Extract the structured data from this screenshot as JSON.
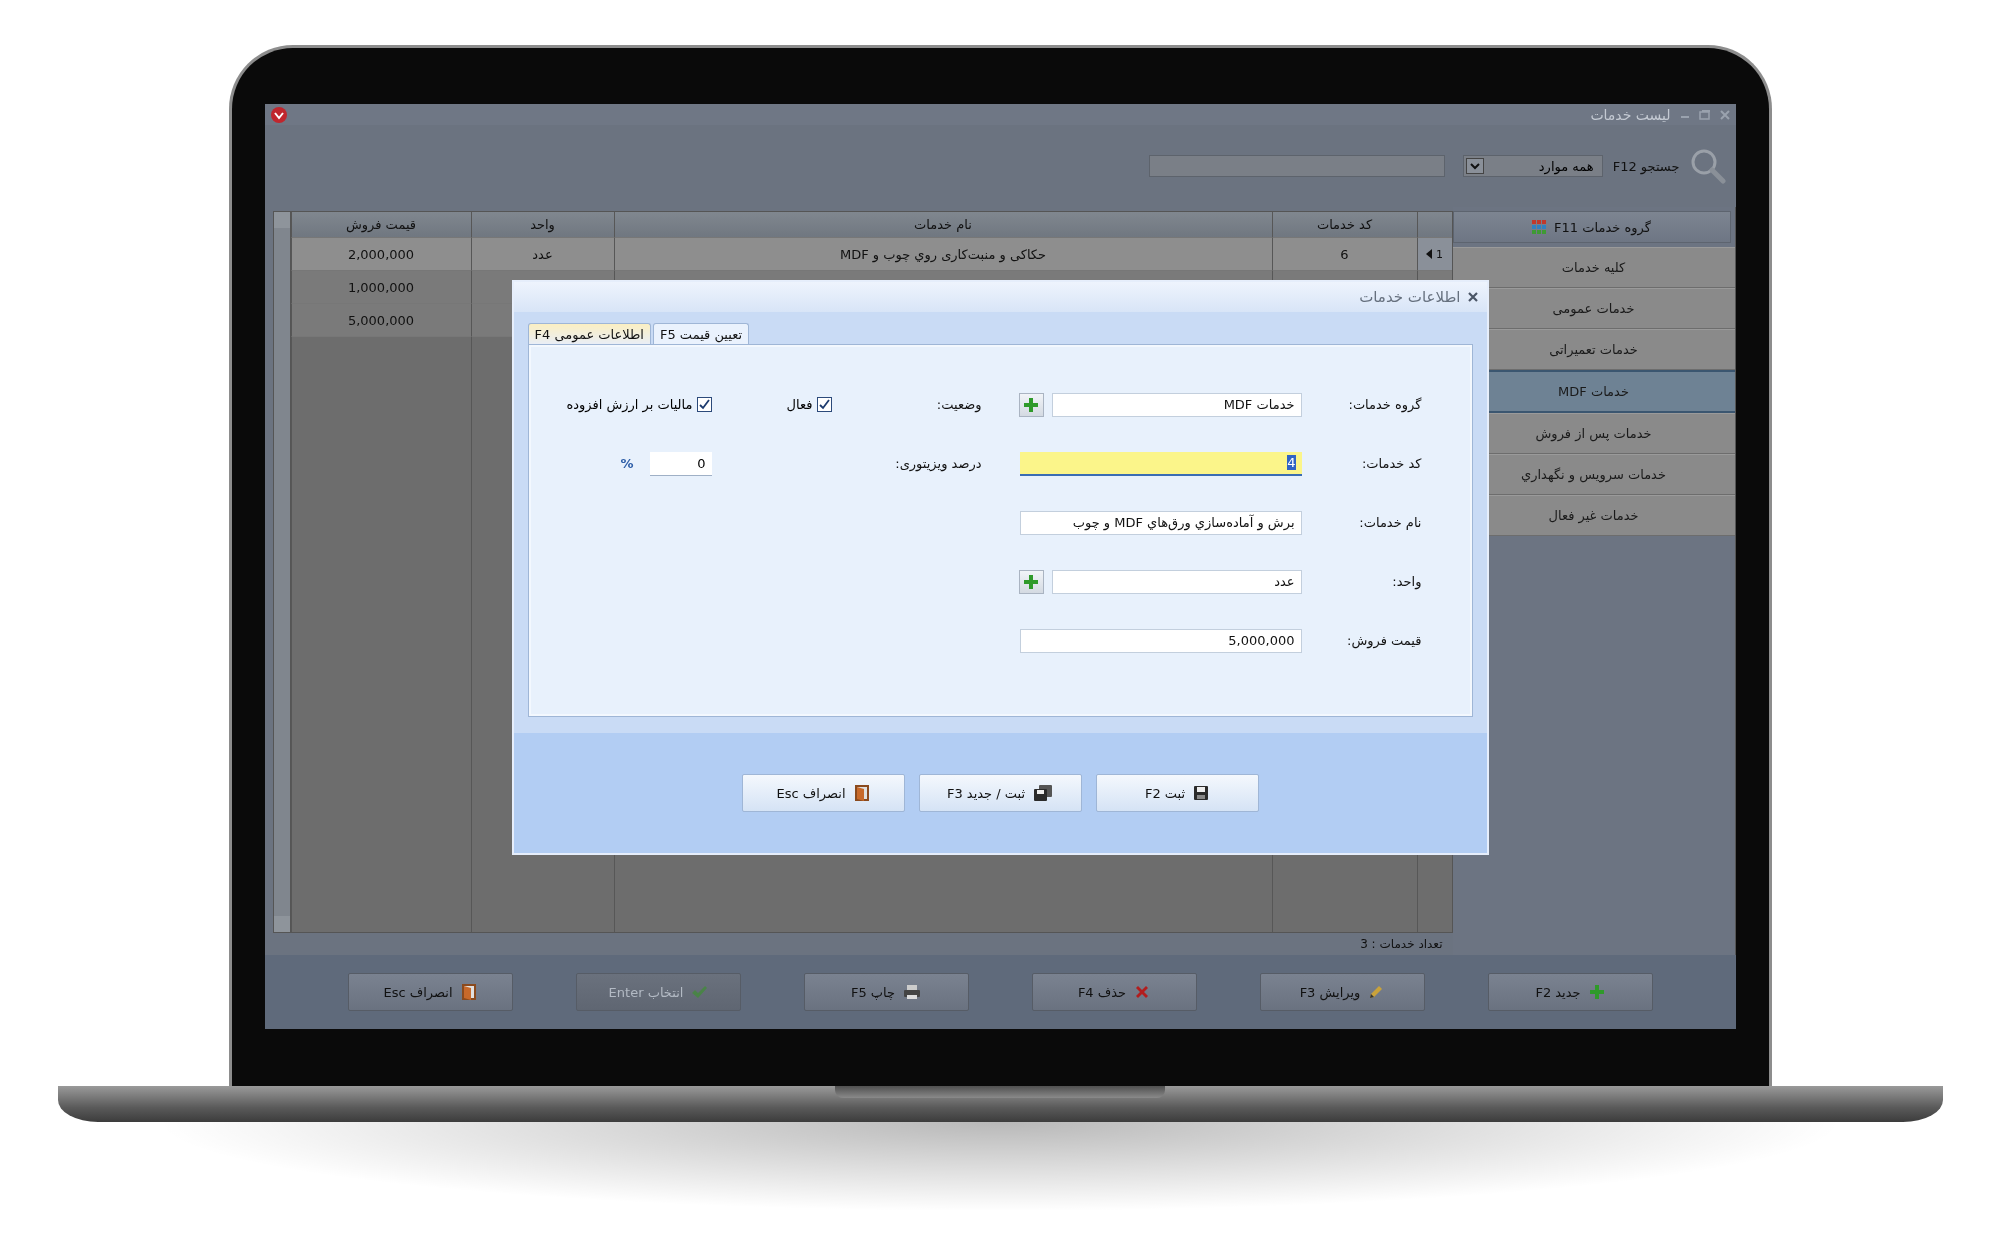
{
  "window": {
    "title": "لیست خدمات"
  },
  "search": {
    "label": "جستجو F12",
    "filter": "همه موارد"
  },
  "table": {
    "columns": [
      "کد خدمات",
      "نام خدمات",
      "واحد",
      "قیمت فروش"
    ],
    "rows": [
      {
        "index": "1",
        "current": true,
        "cells": [
          "6",
          "حکاکی و منبت‌کاری روي چوب و MDF",
          "عدد",
          "2,000,000"
        ]
      },
      {
        "current": false,
        "cells": [
          "1,000,000"
        ]
      },
      {
        "current": false,
        "cells": [
          "5,000,000"
        ]
      }
    ]
  },
  "sidebar": {
    "header": "گروه خدمات F11",
    "items": [
      {
        "label": "کلیه خدمات",
        "selected": false
      },
      {
        "label": "خدمات عمومی",
        "selected": false
      },
      {
        "label": "خدمات تعمیراتی",
        "selected": false
      },
      {
        "label": "خدمات MDF",
        "selected": true
      },
      {
        "label": "خدمات پس از فروش",
        "selected": false
      },
      {
        "label": "خدمات سرویس و نگهداري",
        "selected": false
      },
      {
        "label": "خدمات غیر فعال",
        "selected": false
      }
    ]
  },
  "status_bar": {
    "count": "تعداد خدمات : 3"
  },
  "toolbar": {
    "buttons": [
      {
        "label": "جدید F2",
        "kind": "plus",
        "disabled": false
      },
      {
        "label": "ویرایش F3",
        "kind": "pencil",
        "disabled": false
      },
      {
        "label": "حذف F4",
        "kind": "cross",
        "disabled": false
      },
      {
        "label": "چاپ F5",
        "kind": "printer",
        "disabled": false
      },
      {
        "label": "انتخاب Enter",
        "kind": "check",
        "disabled": true
      },
      {
        "label": "انصراف Esc",
        "kind": "door",
        "disabled": false
      }
    ]
  },
  "dialog": {
    "title": "اطلاعات خدمات",
    "tabs": [
      {
        "label": "تعیین قیمت F5",
        "selected": false
      },
      {
        "label": "اطلاعات عمومی F4",
        "selected": true
      }
    ],
    "fields": [
      {
        "label": "گروه خدمات:",
        "value": "خدمات MDF",
        "kind": "lookup",
        "focused": false
      },
      {
        "label": "کد خدمات:",
        "value": "4",
        "kind": "text",
        "focused": true
      },
      {
        "label": "نام خدمات:",
        "value": "برش و آماده‌سازي ورق‌هاي MDF و چوب",
        "kind": "text",
        "focused": false
      },
      {
        "label": "واحد:",
        "value": "عدد",
        "kind": "lookup",
        "focused": false
      },
      {
        "label": "قیمت فروش:",
        "value": "5,000,000",
        "kind": "number",
        "focused": false
      }
    ],
    "status": {
      "label": "وضعیت:",
      "option": "فعال",
      "checked": true
    },
    "vat": {
      "label": "مالیات بر ارزش افزوده",
      "checked": true
    },
    "visitor": {
      "label": "درصد ویزیتوری:",
      "value": "0",
      "suffix": "%"
    },
    "buttons": [
      {
        "label": "ثبت F2",
        "kind": "save"
      },
      {
        "label": "ثبت / جدید F3",
        "kind": "save-new"
      },
      {
        "label": "انصراف Esc",
        "kind": "door"
      }
    ]
  }
}
